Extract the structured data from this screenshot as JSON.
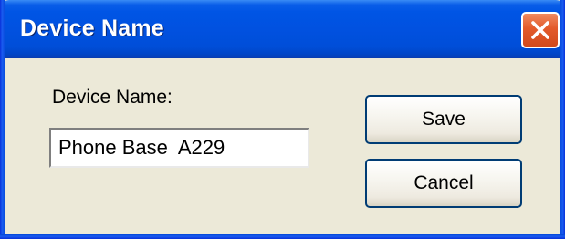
{
  "window": {
    "title": "Device Name"
  },
  "form": {
    "device_name_label": "Device Name:",
    "device_name_value": "Phone Base  A229"
  },
  "buttons": {
    "save_label": "Save",
    "cancel_label": "Cancel"
  },
  "icons": {
    "close": "close-icon"
  },
  "colors": {
    "titlebar": "#0055e5",
    "dialog_bg": "#ece9d8",
    "close_button": "#e35a2a"
  }
}
